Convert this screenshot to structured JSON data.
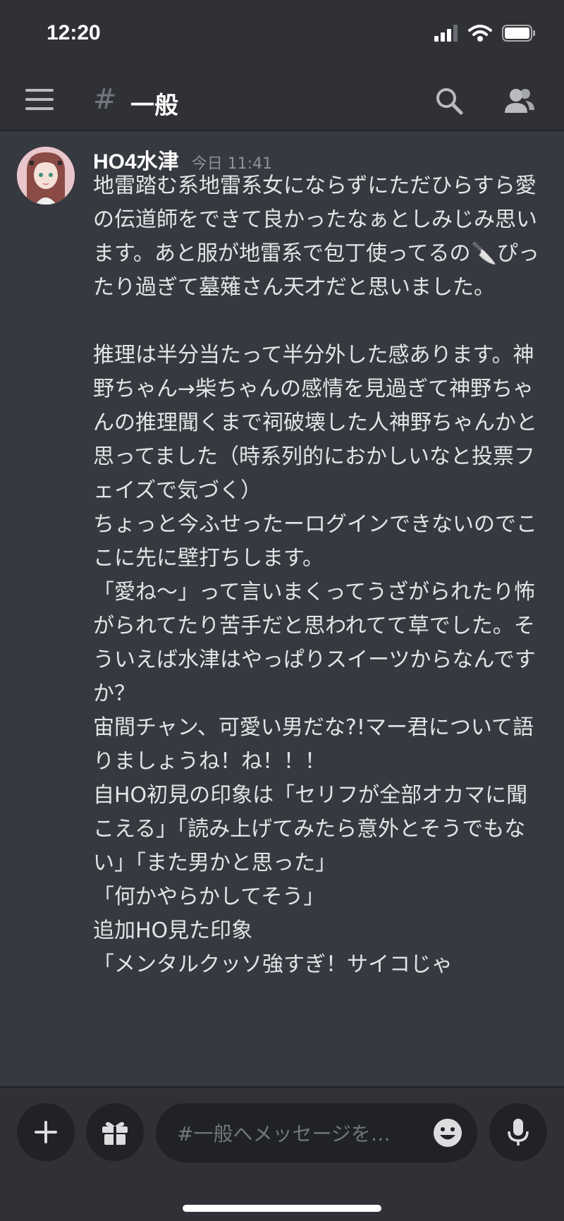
{
  "status_bar": {
    "time": "12:20"
  },
  "header": {
    "hash": "#",
    "channel_name": "一般"
  },
  "message": {
    "author": "HO4水津",
    "timestamp": "今日 11:41",
    "body": "地雷踏む系地雷系女にならずにただひらすら愛の伝道師をできて良かったなぁとしみじみ思います。あと服が地雷系で包丁使ってるの🔪ぴったり過ぎて墓薙さん天才だと思いました。\n\n推理は半分当たって半分外した感あります。神野ちゃん→柴ちゃんの感情を見過ぎて神野ちゃんの推理聞くまで祠破壊した人神野ちゃんかと思ってました（時系列的におかしいなと投票フェイズで気づく）\nちょっと今ふせったーログインできないのでここに先に壁打ちします。\n「愛ね〜」って言いまくってうざがられたり怖がられてたり苦手だと思われてて草でした。そういえば水津はやっぱりスイーツからなんですか？\n宙間チャン、可愛い男だな?!マー君について語りましょうね！ね！！！\n自HO初見の印象は「セリフが全部オカマに聞こえる」「読み上げてみたら意外とそうでもない」「また男かと思った」\n「何かやらかしてそう」\n追加HO見た印象\n「メンタルクッソ強すぎ！サイコじゃ"
  },
  "composer": {
    "placeholder": "#一般へメッセージを…"
  },
  "icons": [
    "signal-icon",
    "wifi-icon",
    "battery-icon",
    "menu-icon",
    "search-icon",
    "members-icon",
    "plus-icon",
    "gift-icon",
    "emoji-icon",
    "microphone-icon"
  ],
  "colors": {
    "background": "#36393f",
    "bars": "#2f3136",
    "input": "#202225"
  }
}
